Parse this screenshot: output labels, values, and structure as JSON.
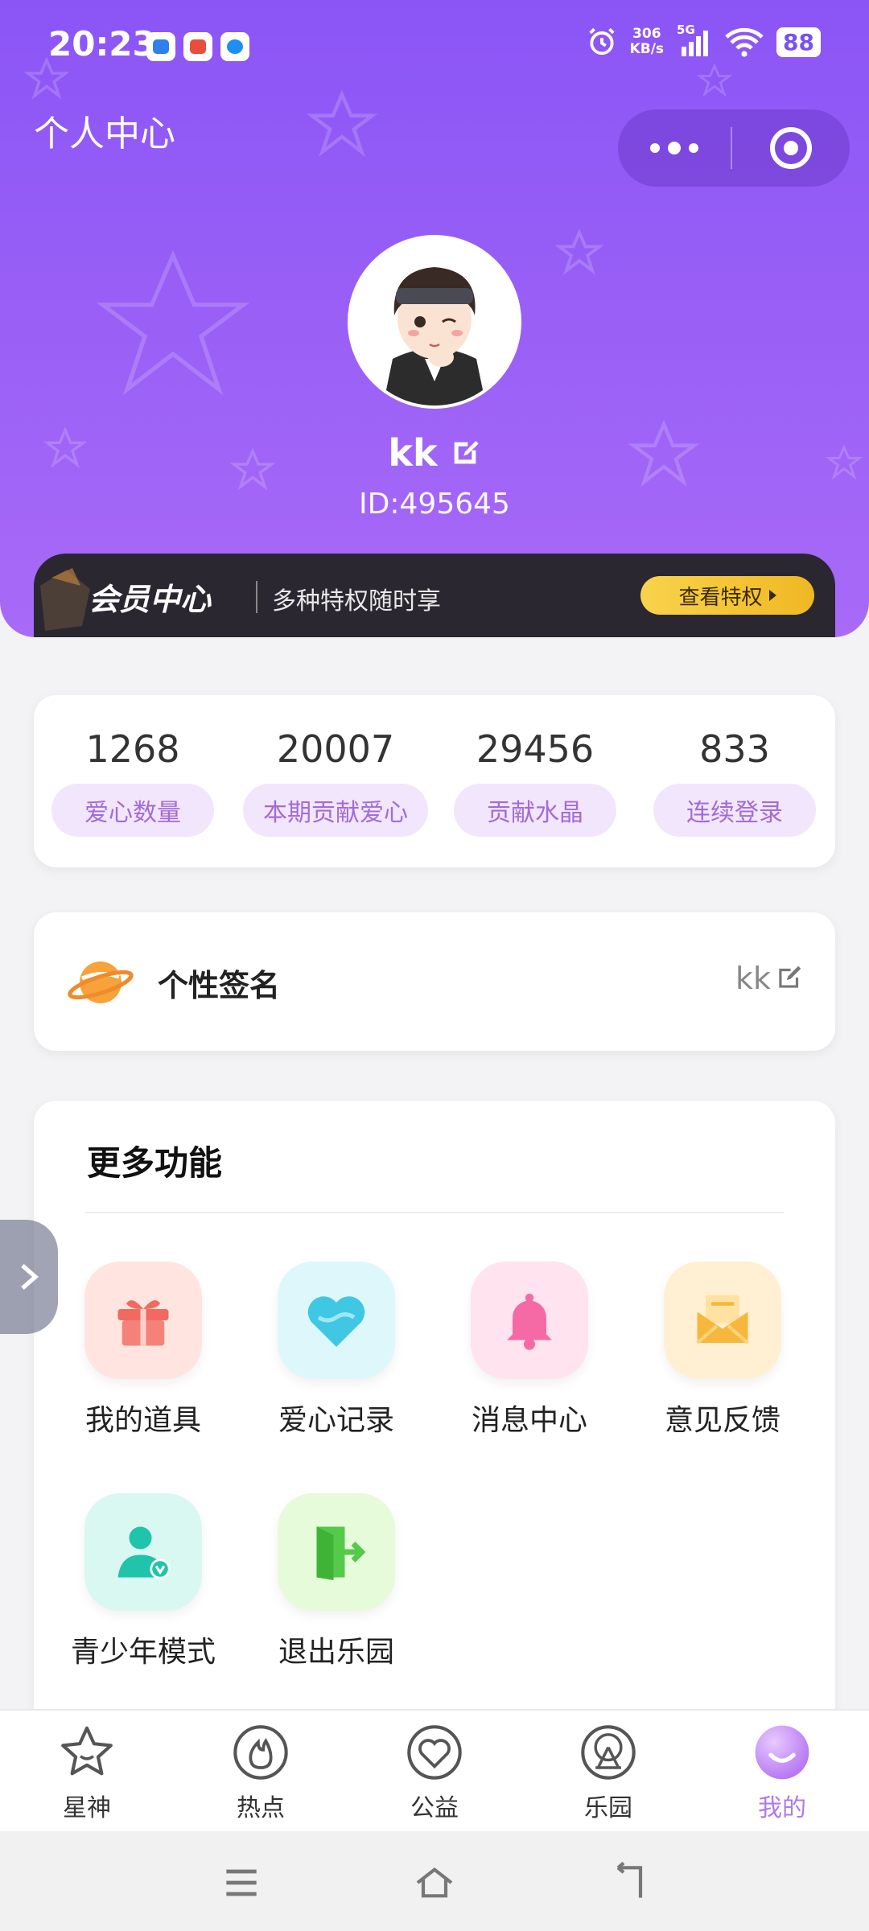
{
  "status_bar": {
    "time": "20:23",
    "net_speed_value": "306",
    "net_speed_unit": "KB/s",
    "network": "5G",
    "battery": "88"
  },
  "header": {
    "title": "个人中心"
  },
  "profile": {
    "username": "kk",
    "user_id": "ID:495645"
  },
  "vip": {
    "title": "会员中心",
    "subtitle": "多种特权随时享",
    "button_label": "查看特权"
  },
  "stats": [
    {
      "value": "1268",
      "label": "爱心数量"
    },
    {
      "value": "20007",
      "label": "本期贡献爱心"
    },
    {
      "value": "29456",
      "label": "贡献水晶"
    },
    {
      "value": "833",
      "label": "连续登录"
    }
  ],
  "signature": {
    "label": "个性签名",
    "value": "kk"
  },
  "more_functions": {
    "title": "更多功能",
    "items": [
      {
        "label": "我的道具",
        "icon": "gift-icon"
      },
      {
        "label": "爱心记录",
        "icon": "heart-icon"
      },
      {
        "label": "消息中心",
        "icon": "bell-icon"
      },
      {
        "label": "意见反馈",
        "icon": "envelope-icon"
      },
      {
        "label": "青少年模式",
        "icon": "teen-mode-icon"
      },
      {
        "label": "退出乐园",
        "icon": "exit-icon"
      }
    ]
  },
  "tabbar": {
    "items": [
      {
        "label": "星神",
        "icon": "star-icon"
      },
      {
        "label": "热点",
        "icon": "flame-icon"
      },
      {
        "label": "公益",
        "icon": "heart-outline-icon"
      },
      {
        "label": "乐园",
        "icon": "ferris-wheel-icon"
      },
      {
        "label": "我的",
        "icon": "smile-icon",
        "active": true
      }
    ]
  },
  "colors": {
    "header_purple": "#8b55f6",
    "accent_lavender": "#b07ae8",
    "pill_bg": "#f1e6fb",
    "vip_gold": "#f5c83a"
  }
}
